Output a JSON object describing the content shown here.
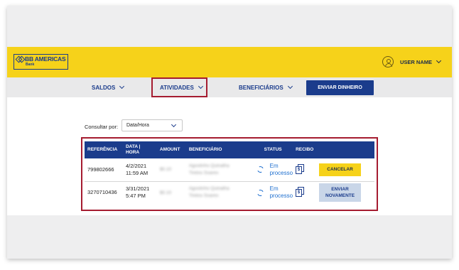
{
  "brand": {
    "logo_text": "BB AMERICAS",
    "logo_sub": "Bank"
  },
  "user": {
    "name": "USER NAME"
  },
  "nav": {
    "items": [
      {
        "label": "SALDOS"
      },
      {
        "label": "ATIVIDADES"
      },
      {
        "label": "BENEFICIÁRIOS"
      }
    ],
    "send_button": "ENVIAR DINHEIRO"
  },
  "filter": {
    "label": "Consultar por:",
    "selected": "Data/Hora"
  },
  "table": {
    "headers": {
      "ref": "REFERÊNCIA",
      "date_line1": "DATA |",
      "date_line2": "HORA",
      "amount": "AMOUNT",
      "beneficiary": "BENEFICIÁRIO",
      "status": "STATUS",
      "receipt": "RECIBO"
    },
    "rows": [
      {
        "ref": "799802666",
        "date": "4/2/2021",
        "time": "11:59 AM",
        "amount": "$0.10",
        "beneficiary_line1": "Agostinho Quinalha",
        "beneficiary_line2": "Tirelos Soares",
        "status_line1": "Em",
        "status_line2": "processo",
        "action_line1": "CANCELAR",
        "action_line2": ""
      },
      {
        "ref": "3270710436",
        "date": "3/31/2021",
        "time": "5:47 PM",
        "amount": "$0.10",
        "beneficiary_line1": "Agostinho Quinalha",
        "beneficiary_line2": "Tirelos Soares",
        "status_line1": "Em",
        "status_line2": "processo",
        "action_line1": "ENVIAR",
        "action_line2": "NOVAMENTE"
      }
    ]
  },
  "colors": {
    "yellow": "#f6d21a",
    "navy": "#1b3c8c",
    "highlight": "#a51c30",
    "status_blue": "#1e6fcf"
  }
}
